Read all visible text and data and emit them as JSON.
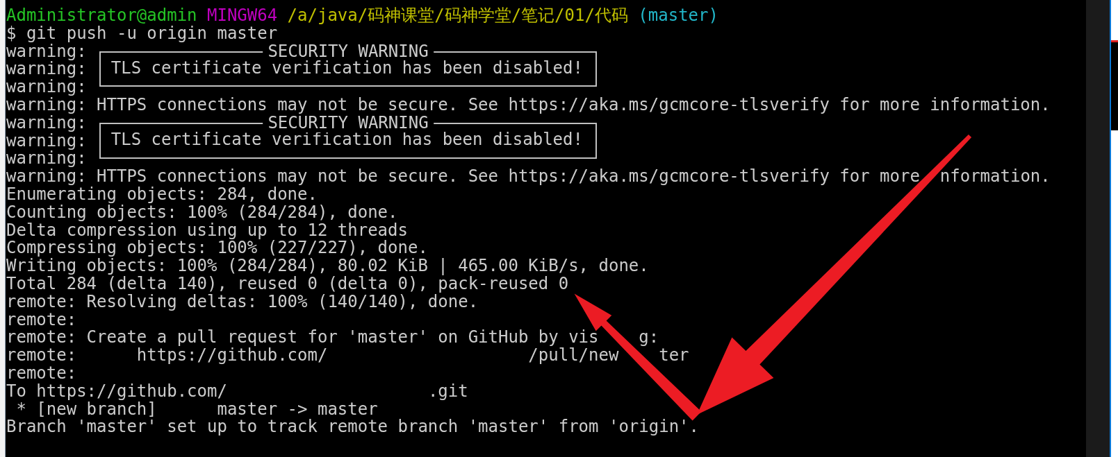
{
  "prompt": {
    "user": "Administrator@admin",
    "system": "MINGW64",
    "path": "/a/java/码神课堂/码神学堂/笔记/01/代码",
    "branch": "(master)"
  },
  "lines": [
    {
      "kind": "text",
      "text": "$ git push -u origin master"
    },
    {
      "kind": "box",
      "prefixes": [
        "warning:",
        "warning:",
        "warning:"
      ],
      "title": "SECURITY WARNING",
      "message": "TLS certificate verification has been disabled!"
    },
    {
      "kind": "text",
      "text": "warning: HTTPS connections may not be secure. See https://aka.ms/gcmcore-tlsverify for more information."
    },
    {
      "kind": "box",
      "prefixes": [
        "warning:",
        "warning:",
        "warning:"
      ],
      "title": "SECURITY WARNING",
      "message": "TLS certificate verification has been disabled!"
    },
    {
      "kind": "split",
      "parts": [
        "warning: HTTPS connections may not be secure. See https://aka.ms/gcmcore-tlsverify for more",
        "nformation."
      ]
    },
    {
      "kind": "text",
      "text": "Enumerating objects: 284, done."
    },
    {
      "kind": "text",
      "text": "Counting objects: 100% (284/284), done."
    },
    {
      "kind": "text",
      "text": "Delta compression using up to 12 threads"
    },
    {
      "kind": "text",
      "text": "Compressing objects: 100% (227/227), done."
    },
    {
      "kind": "text",
      "text": "Writing objects: 100% (284/284), 80.02 KiB | 465.00 KiB/s, done."
    },
    {
      "kind": "text",
      "text": "Total 284 (delta 140), reused 0 (delta 0), pack-reused 0"
    },
    {
      "kind": "text",
      "text": "remote: Resolving deltas: 100% (140/140), done."
    },
    {
      "kind": "text",
      "text": "remote:"
    },
    {
      "kind": "split",
      "parts": [
        "remote: Create a pull request for 'master' on GitHub by vis",
        "g:"
      ]
    },
    {
      "kind": "split",
      "parts": [
        "remote:      https://github.com/",
        "/pull/new",
        "ter"
      ]
    },
    {
      "kind": "text",
      "text": "remote:"
    },
    {
      "kind": "split",
      "parts": [
        "To https://github.com/",
        ".git"
      ]
    },
    {
      "kind": "text",
      "text": " * [new branch]      master -> master"
    },
    {
      "kind": "text",
      "text": "Branch 'master' set up to track remote branch 'master' from 'origin'."
    }
  ]
}
